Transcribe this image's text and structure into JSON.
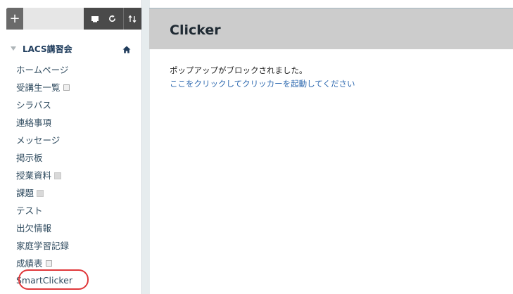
{
  "toolbar": {
    "add_label": "+",
    "view_icon": "rectangle-icon",
    "refresh_icon": "refresh-icon",
    "sort_icon": "sort-icon"
  },
  "course": {
    "name": "LACS講習会",
    "home_icon": "home-icon"
  },
  "menu": {
    "items": [
      {
        "label": "ホームページ"
      },
      {
        "label": "受講生一覧"
      },
      {
        "label": "シラバス"
      },
      {
        "label": "連絡事項"
      },
      {
        "label": "メッセージ"
      },
      {
        "label": "掲示板"
      },
      {
        "label": "授業資料"
      },
      {
        "label": "課題"
      },
      {
        "label": "テスト"
      },
      {
        "label": "出欠情報"
      },
      {
        "label": "家庭学習記録"
      },
      {
        "label": "成績表"
      },
      {
        "label": "SmartClicker"
      }
    ]
  },
  "main": {
    "title": "Clicker",
    "message": "ポップアップがブロックされました。",
    "link": "ここをクリックしてクリッカーを起動してください"
  },
  "colors": {
    "highlight": "#e0383b",
    "title_bar": "#cccccc",
    "link": "#2f6ab0",
    "toolbar": "#4a4a4a"
  }
}
